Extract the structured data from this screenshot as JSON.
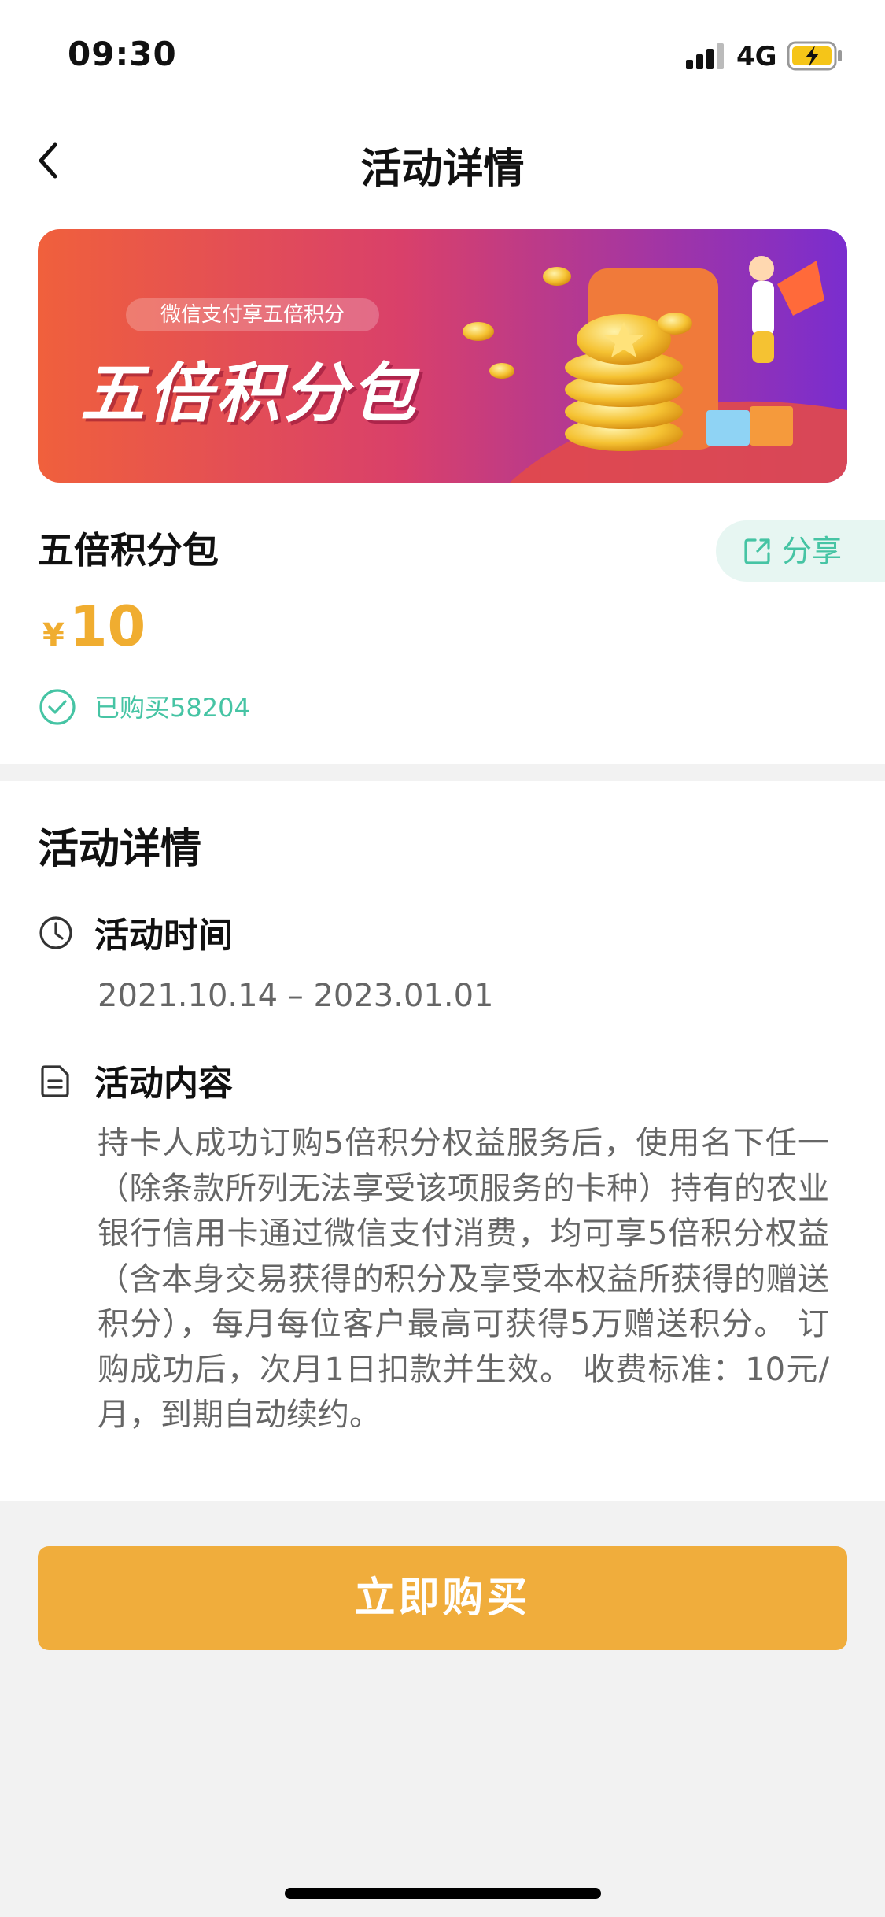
{
  "status_bar": {
    "time": "09:30",
    "network": "4G"
  },
  "nav": {
    "title": "活动详情"
  },
  "banner": {
    "tag": "微信支付享五倍积分",
    "title": "五倍积分包"
  },
  "product": {
    "name": "五倍积分包",
    "share_label": "分享",
    "currency_symbol": "¥",
    "price": "10",
    "purchased_text": "已购买58204"
  },
  "details": {
    "title": "活动详情",
    "time_label": "活动时间",
    "date_range": "2021.10.14 – 2023.01.01",
    "content_label": "活动内容",
    "content_text": "持卡人成功订购5倍积分权益服务后，使用名下任一（除条款所列无法享受该项服务的卡种）持有的农业银行信用卡通过微信支付消费，均可享5倍积分权益（含本身交易获得的积分及享受本权益所获得的赠送积分），每月每位客户最高可获得5万赠送积分。 订购成功后，次月1日扣款并生效。 收费标准：10元/月，到期自动续约。"
  },
  "actions": {
    "buy_label": "立即购买"
  },
  "colors": {
    "accent_teal": "#46c4a4",
    "price_orange": "#f0ad30",
    "button_orange": "#f0ad3c"
  }
}
